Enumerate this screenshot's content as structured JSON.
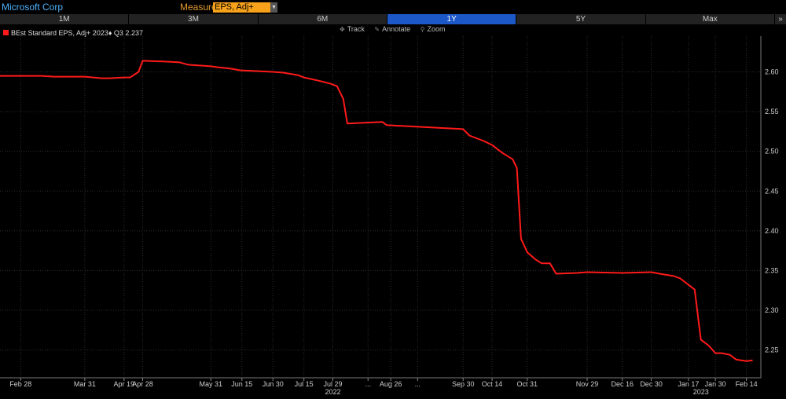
{
  "header": {
    "company": "Microsoft Corp",
    "measure_label": "Measure",
    "measure_value": "EPS, Adj+"
  },
  "range_buttons": [
    {
      "label": "1M",
      "active": false
    },
    {
      "label": "3M",
      "active": false
    },
    {
      "label": "6M",
      "active": false
    },
    {
      "label": "1Y",
      "active": true
    },
    {
      "label": "5Y",
      "active": false
    },
    {
      "label": "Max",
      "active": false
    }
  ],
  "range_more": "»",
  "tools": [
    {
      "label": "Track",
      "icon": "crosshair-icon"
    },
    {
      "label": "Annotate",
      "icon": "pencil-icon"
    },
    {
      "label": "Zoom",
      "icon": "magnifier-icon"
    }
  ],
  "colors": {
    "series": "#ff1a1a",
    "active_tab": "#1c58c7",
    "measure_bg": "#f7a21a"
  },
  "chart_data": {
    "type": "line",
    "legend": "BEst Standard EPS, Adj+ 2023♦ Q3 2.237",
    "ylim": [
      2.215,
      2.645
    ],
    "y_ticks": [
      2.25,
      2.3,
      2.35,
      2.4,
      2.45,
      2.5,
      2.55,
      2.6
    ],
    "y_tick_labels": [
      "2.25",
      "2.30",
      "2.35",
      "2.40",
      "2.45",
      "2.50",
      "2.55",
      "2.60"
    ],
    "x_range": [
      "2022-02-18",
      "2023-02-21"
    ],
    "x_ticks": [
      {
        "date": "2022-02-28",
        "label": "Feb 28"
      },
      {
        "date": "2022-03-31",
        "label": "Mar 31"
      },
      {
        "date": "2022-04-19",
        "label": "Apr 19"
      },
      {
        "date": "2022-04-28",
        "label": "Apr 28"
      },
      {
        "date": "2022-05-31",
        "label": "May 31"
      },
      {
        "date": "2022-06-15",
        "label": "Jun 15"
      },
      {
        "date": "2022-06-30",
        "label": "Jun 30"
      },
      {
        "date": "2022-07-15",
        "label": "Jul 15"
      },
      {
        "date": "2022-07-29",
        "label": "Jul 29"
      },
      {
        "date": "2022-08-15",
        "label": "..."
      },
      {
        "date": "2022-08-26",
        "label": "Aug 26"
      },
      {
        "date": "2022-09-08",
        "label": "..."
      },
      {
        "date": "2022-09-30",
        "label": "Sep 30"
      },
      {
        "date": "2022-10-14",
        "label": "Oct 14"
      },
      {
        "date": "2022-10-31",
        "label": "Oct 31"
      },
      {
        "date": "2022-11-29",
        "label": "Nov 29"
      },
      {
        "date": "2022-12-16",
        "label": "Dec 16"
      },
      {
        "date": "2022-12-30",
        "label": "Dec 30"
      },
      {
        "date": "2023-01-17",
        "label": "Jan 17"
      },
      {
        "date": "2023-01-30",
        "label": "Jan 30"
      },
      {
        "date": "2023-02-14",
        "label": "Feb 14"
      }
    ],
    "year_labels": [
      {
        "date": "2022-07-29",
        "label": "2022"
      },
      {
        "date": "2023-01-23",
        "label": "2023"
      }
    ],
    "series": [
      {
        "x": [
          "2022-02-18",
          "2022-03-10",
          "2022-03-16",
          "2022-03-31",
          "2022-04-08",
          "2022-04-12",
          "2022-04-19",
          "2022-04-22",
          "2022-04-26",
          "2022-04-28",
          "2022-05-09",
          "2022-05-16",
          "2022-05-20",
          "2022-05-31",
          "2022-06-03",
          "2022-06-10",
          "2022-06-14",
          "2022-06-30",
          "2022-07-05",
          "2022-07-12",
          "2022-07-15",
          "2022-07-22",
          "2022-07-28",
          "2022-07-31",
          "2022-08-03",
          "2022-08-05",
          "2022-08-22",
          "2022-08-24",
          "2022-09-30",
          "2022-10-03",
          "2022-10-10",
          "2022-10-14",
          "2022-10-17",
          "2022-10-19",
          "2022-10-24",
          "2022-10-26",
          "2022-10-28",
          "2022-10-31",
          "2022-11-04",
          "2022-11-07",
          "2022-11-11",
          "2022-11-14",
          "2022-11-24",
          "2022-11-29",
          "2022-12-16",
          "2022-12-30",
          "2023-01-03",
          "2023-01-10",
          "2023-01-13",
          "2023-01-20",
          "2023-01-23",
          "2023-01-27",
          "2023-01-30",
          "2023-02-02",
          "2023-02-06",
          "2023-02-09",
          "2023-02-14",
          "2023-02-17"
        ],
        "y": [
          2.595,
          2.595,
          2.594,
          2.594,
          2.592,
          2.592,
          2.593,
          2.593,
          2.6,
          2.614,
          2.613,
          2.612,
          2.609,
          2.607,
          2.606,
          2.604,
          2.602,
          2.6,
          2.599,
          2.596,
          2.593,
          2.589,
          2.585,
          2.582,
          2.566,
          2.535,
          2.537,
          2.533,
          2.528,
          2.52,
          2.513,
          2.508,
          2.502,
          2.498,
          2.49,
          2.479,
          2.39,
          2.373,
          2.364,
          2.359,
          2.359,
          2.346,
          2.347,
          2.348,
          2.347,
          2.348,
          2.346,
          2.343,
          2.34,
          2.326,
          2.263,
          2.255,
          2.246,
          2.246,
          2.244,
          2.238,
          2.236,
          2.237
        ]
      }
    ]
  }
}
